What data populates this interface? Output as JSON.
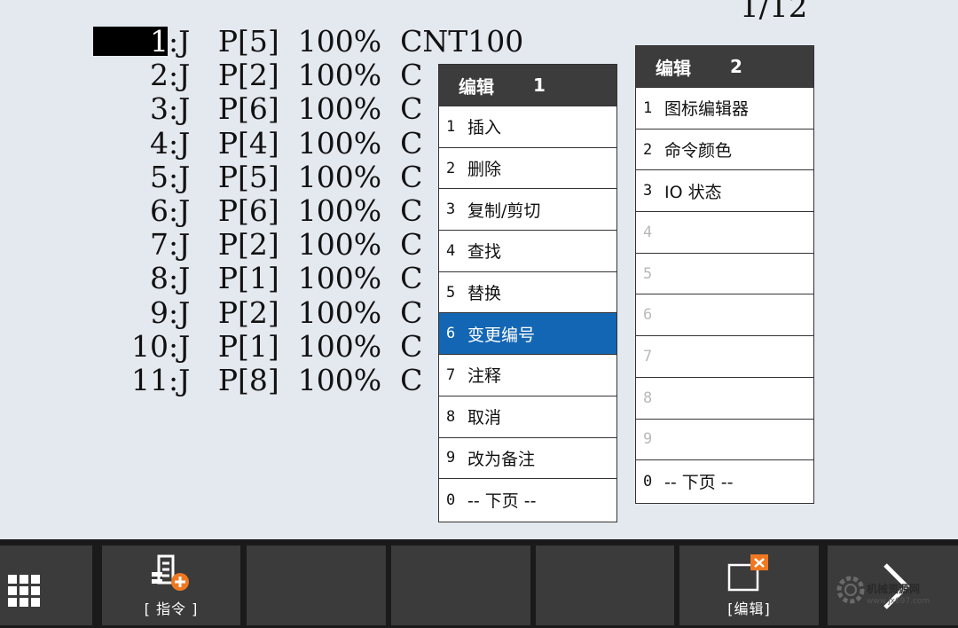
{
  "page_indicator": "1/12",
  "program_lines": [
    {
      "num": "1",
      "text": ":J   P[5]  100%  CNT100",
      "selected": true
    },
    {
      "num": "2",
      "text": ":J   P[2]  100%  C"
    },
    {
      "num": "3",
      "text": ":J   P[6]  100%  C"
    },
    {
      "num": "4",
      "text": ":J   P[4]  100%  C"
    },
    {
      "num": "5",
      "text": ":J   P[5]  100%  C"
    },
    {
      "num": "6",
      "text": ":J   P[6]  100%  C"
    },
    {
      "num": "7",
      "text": ":J   P[2]  100%  C"
    },
    {
      "num": "8",
      "text": ":J   P[1]  100%  C"
    },
    {
      "num": "9",
      "text": ":J   P[2]  100%  C"
    },
    {
      "num": "10",
      "text": ":J   P[1]  100%  C"
    },
    {
      "num": "11",
      "text": ":J   P[8]  100%  C"
    }
  ],
  "menu1": {
    "title": "编辑",
    "number": "1",
    "items": [
      {
        "n": "1",
        "label": "插入"
      },
      {
        "n": "2",
        "label": "删除"
      },
      {
        "n": "3",
        "label": "复制/剪切"
      },
      {
        "n": "4",
        "label": "查找"
      },
      {
        "n": "5",
        "label": "替换"
      },
      {
        "n": "6",
        "label": "变更编号",
        "active": true
      },
      {
        "n": "7",
        "label": "注释"
      },
      {
        "n": "8",
        "label": "取消"
      },
      {
        "n": "9",
        "label": "改为备注"
      },
      {
        "n": "0",
        "label": "-- 下页 --"
      }
    ]
  },
  "menu2": {
    "title": "编辑",
    "number": "2",
    "items": [
      {
        "n": "1",
        "label": "图标编辑器"
      },
      {
        "n": "2",
        "label": "命令颜色"
      },
      {
        "n": "3",
        "label": "IO 状态"
      },
      {
        "n": "4",
        "label": ""
      },
      {
        "n": "5",
        "label": ""
      },
      {
        "n": "6",
        "label": ""
      },
      {
        "n": "7",
        "label": ""
      },
      {
        "n": "8",
        "label": ""
      },
      {
        "n": "9",
        "label": ""
      },
      {
        "n": "0",
        "label": "-- 下页 --"
      }
    ]
  },
  "softkeys": {
    "instruction_label": "[ 指令 ]",
    "edit_label": "[编辑]"
  },
  "watermark": {
    "text": "机械资源网",
    "url": "www.jx697.com"
  },
  "colors": {
    "background": "#e4e8ef",
    "menu_header": "#3c3c3c",
    "active_item": "#1366b4",
    "softbar": "#1a1a1a",
    "softkey": "#3b3b3b",
    "badge": "#f07820"
  }
}
